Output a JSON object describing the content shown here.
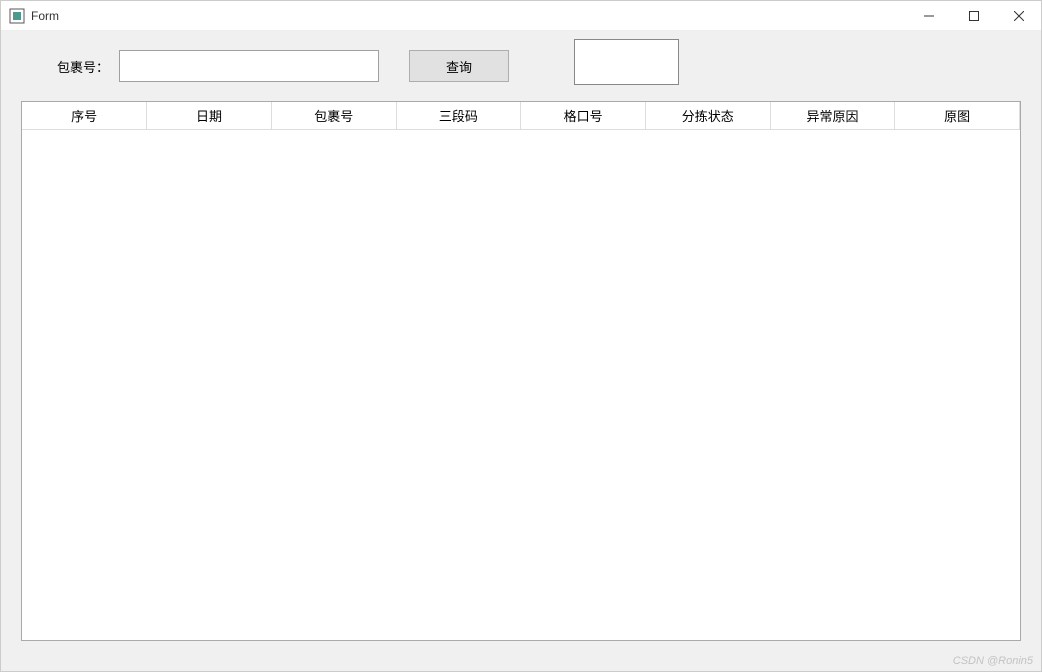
{
  "window": {
    "title": "Form"
  },
  "search": {
    "label": "包裹号：",
    "input_value": "",
    "input_placeholder": "",
    "button_label": "查询"
  },
  "table": {
    "columns": [
      "序号",
      "日期",
      "包裹号",
      "三段码",
      "格口号",
      "分拣状态",
      "异常原因",
      "原图"
    ],
    "rows": []
  },
  "watermark": "CSDN @Ronin5"
}
